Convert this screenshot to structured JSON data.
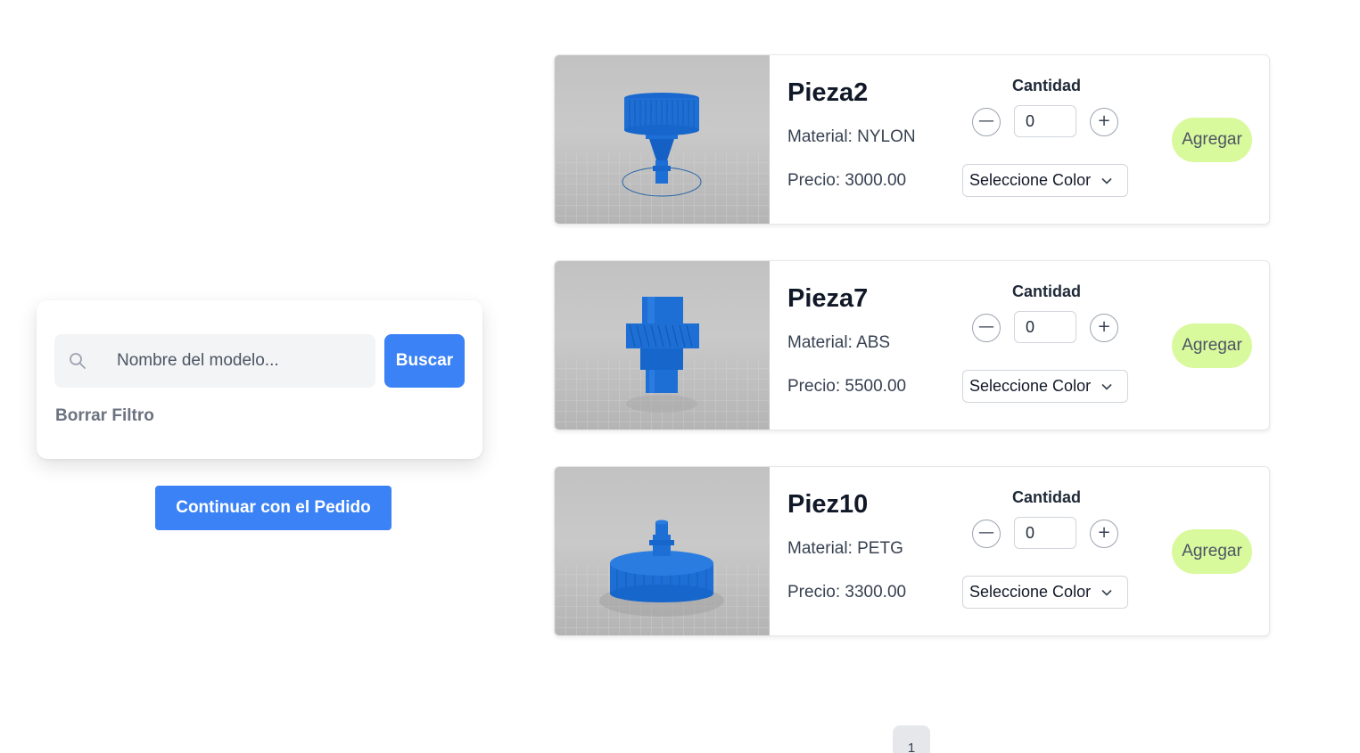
{
  "filter": {
    "search_placeholder": "Nombre del modelo...",
    "search_button": "Buscar",
    "clear_filter": "Borrar Filtro"
  },
  "continue_button": "Continuar con el Pedido",
  "products": [
    {
      "name": "Pieza2",
      "material": "Material: NYLON",
      "price": "Precio: 3000.00",
      "quantity_label": "Cantidad",
      "quantity": "0",
      "color_select": "Seleccione Color",
      "add_button": "Agregar",
      "model_icon": "connector-model"
    },
    {
      "name": "Pieza7",
      "material": "Material: ABS",
      "price": "Precio: 5500.00",
      "quantity_label": "Cantidad",
      "quantity": "0",
      "color_select": "Seleccione Color",
      "add_button": "Agregar",
      "model_icon": "gear-shaft-model"
    },
    {
      "name": "Piez10",
      "material": "Material: PETG",
      "price": "Precio: 3300.00",
      "quantity_label": "Cantidad",
      "quantity": "0",
      "color_select": "Seleccione Color",
      "add_button": "Agregar",
      "model_icon": "cap-nozzle-model"
    }
  ],
  "pagination": {
    "current_page": "1"
  },
  "colors": {
    "primary": "#3b82f6",
    "add_button": "#d9f99d",
    "model_blue": "#1d6fd6"
  }
}
